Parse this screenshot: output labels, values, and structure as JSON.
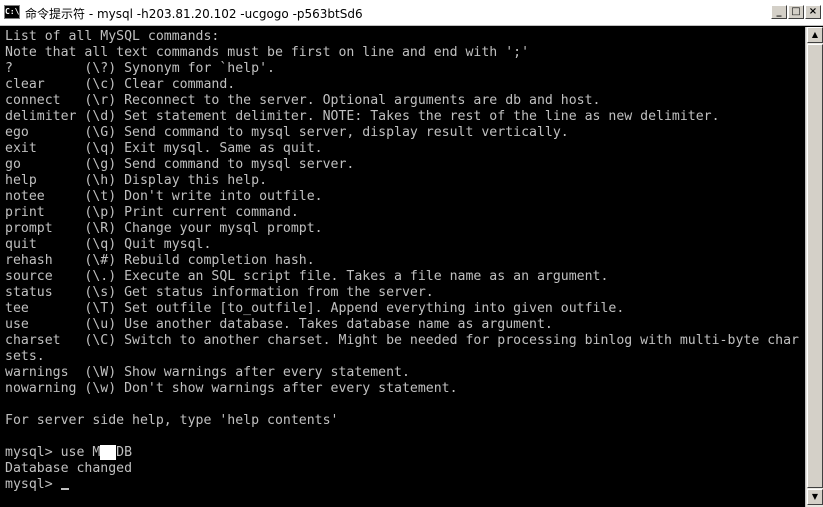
{
  "window": {
    "title": "命令提示符 - mysql -h203.81.20.102 -ucgogo -p563btSd6",
    "icon": "console-icon",
    "controls": {
      "minimize": "_",
      "maximize": "□",
      "close": "×"
    }
  },
  "console": {
    "lines": [
      "List of all MySQL commands:",
      "Note that all text commands must be first on line and end with ';'",
      "?         (\\?) Synonym for `help'.",
      "clear     (\\c) Clear command.",
      "connect   (\\r) Reconnect to the server. Optional arguments are db and host.",
      "delimiter (\\d) Set statement delimiter. NOTE: Takes the rest of the line as new delimiter.",
      "ego       (\\G) Send command to mysql server, display result vertically.",
      "exit      (\\q) Exit mysql. Same as quit.",
      "go        (\\g) Send command to mysql server.",
      "help      (\\h) Display this help.",
      "notee     (\\t) Don't write into outfile.",
      "print     (\\p) Print current command.",
      "prompt    (\\R) Change your mysql prompt.",
      "quit      (\\q) Quit mysql.",
      "rehash    (\\#) Rebuild completion hash.",
      "source    (\\.) Execute an SQL script file. Takes a file name as an argument.",
      "status    (\\s) Get status information from the server.",
      "tee       (\\T) Set outfile [to_outfile]. Append everything into given outfile.",
      "use       (\\u) Use another database. Takes database name as argument.",
      "charset   (\\C) Switch to another charset. Might be needed for processing binlog with multi-byte char",
      "sets.",
      "warnings  (\\W) Show warnings after every statement.",
      "nowarning (\\w) Don't show warnings after every statement.",
      "",
      "For server side help, type 'help contents'",
      ""
    ],
    "use_command": {
      "prefix": "mysql> use M",
      "hidden": "  ",
      "suffix": "DB"
    },
    "db_changed": "Database changed",
    "prompt": "mysql> "
  },
  "scrollbar": {
    "up_arrow": "▲",
    "down_arrow": "▼"
  },
  "colors": {
    "console_bg": "#000000",
    "console_fg": "#c0c0c0",
    "titlebar_bg": "#ffffff"
  }
}
